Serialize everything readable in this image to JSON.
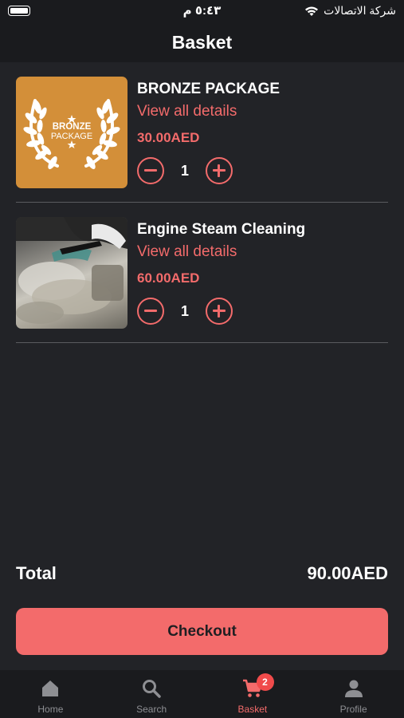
{
  "status_bar": {
    "time": "٥:٤٣ م",
    "carrier": "شركة الاتصالات"
  },
  "header": {
    "title": "Basket"
  },
  "items": [
    {
      "title": "BRONZE PACKAGE",
      "link": "View all details",
      "price": "30.00AED",
      "quantity": "1",
      "thumb_line1": "BRONZE",
      "thumb_line2": "PACKAGE",
      "thumb_icon": "laurel-wreath-icon"
    },
    {
      "title": "Engine Steam Cleaning",
      "link": "View all details",
      "price": "60.00AED",
      "quantity": "1",
      "thumb_icon": "engine-photo"
    }
  ],
  "total": {
    "label": "Total",
    "value": "90.00AED"
  },
  "checkout_label": "Checkout",
  "tabbar": {
    "tabs": [
      {
        "label": "Home",
        "icon": "home-icon"
      },
      {
        "label": "Search",
        "icon": "search-icon"
      },
      {
        "label": "Basket",
        "icon": "cart-icon",
        "badge": "2",
        "active": true
      },
      {
        "label": "Profile",
        "icon": "person-icon"
      }
    ]
  },
  "colors": {
    "accent": "#f36b6b",
    "background": "#222327",
    "bar_background": "#1a1b1e",
    "bronze": "#d38f39",
    "inactive_tab": "#8e8f93"
  }
}
